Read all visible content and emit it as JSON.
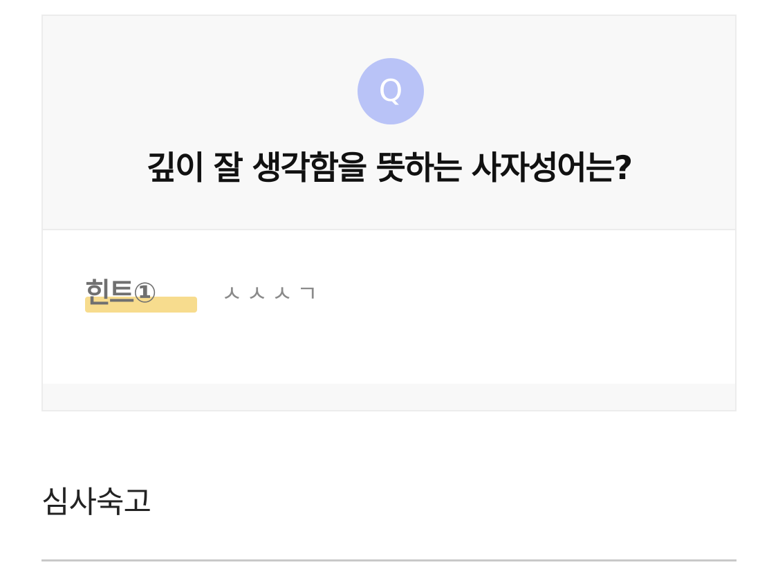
{
  "question": {
    "badge": "Q",
    "text": "깊이 잘 생각함을 뜻하는 사자성어는?"
  },
  "hint": {
    "label": "힌트①",
    "value": "ㅅㅅㅅㄱ"
  },
  "answer": {
    "text": "심사숙고"
  },
  "colors": {
    "badge": "#b9c3f7",
    "hint_highlight": "#f7dc8e",
    "card_background": "#f8f8f8"
  }
}
